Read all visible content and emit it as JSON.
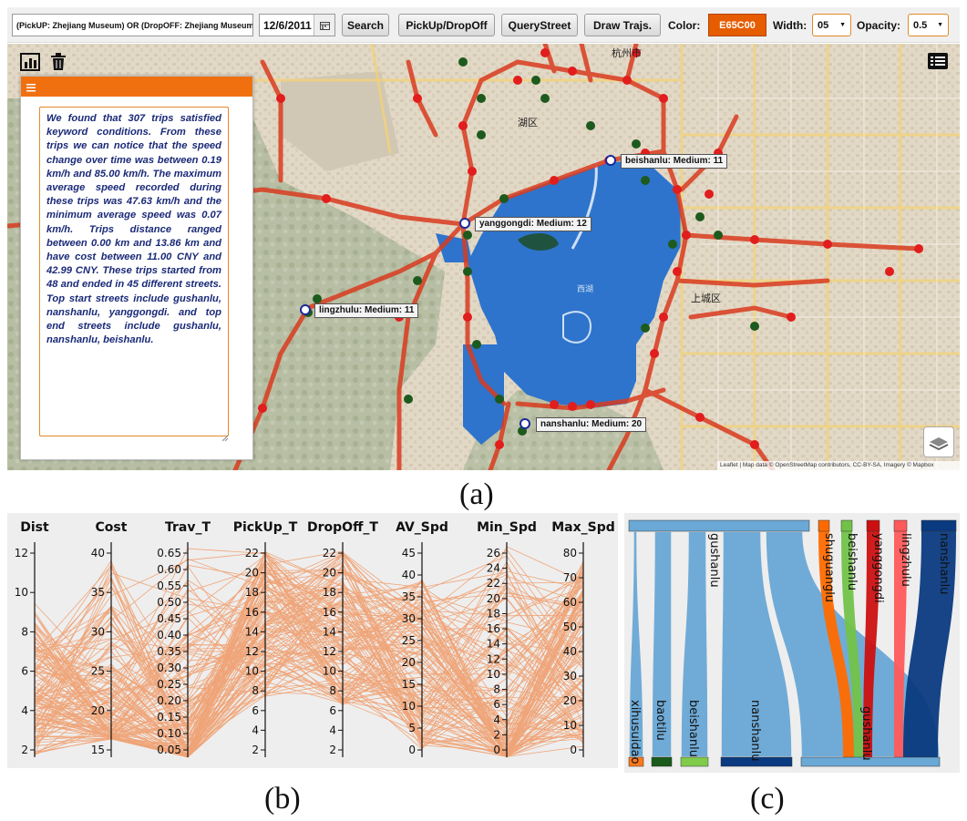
{
  "toolbar": {
    "query": "(PickUP: Zhejiang Museum) OR (DropOFF: Zhejiang Museum)",
    "date": "12/6/2011",
    "calendar_icon": "calendar-icon",
    "search_label": "Search",
    "pickup_label": "PickUp/DropOff",
    "querystreet_label": "QueryStreet",
    "draw_label": "Draw Trajs.",
    "color_label": "Color:",
    "color_value": "E65C00",
    "width_label": "Width:",
    "width_value": "05",
    "opacity_label": "Opacity:",
    "opacity_value": "0.5"
  },
  "colors": {
    "accent": "#E65C00",
    "water": "#2e74cc",
    "trajectory": "#d93b1f",
    "node_red": "#e11d1d",
    "node_green": "#1d5a1d"
  },
  "map": {
    "district_labels": [
      "杭州市",
      "湖区",
      "西湖",
      "上城区"
    ],
    "markers": [
      {
        "name": "beishanlu",
        "label": "beishanlu: Medium: 11"
      },
      {
        "name": "yanggongdi",
        "label": "yanggongdi: Medium: 12"
      },
      {
        "name": "lingzhulu",
        "label": "lingzhulu: Medium: 11"
      },
      {
        "name": "nanshanlu",
        "label": "nanshanlu: Medium: 20"
      }
    ],
    "attribution": "Leaflet | Map data © OpenStreetMap contributors, CC-BY-SA, Imagery © Mapbox"
  },
  "panel": {
    "summary": "We found that 307 trips satisfied keyword conditions. From these trips we can notice that the speed change over time was between 0.19 km/h and 85.00 km/h. The maximum average speed recorded during these trips was 47.63 km/h and the minimum average speed was 0.07 km/h. Trips distance ranged between 0.00 km and 13.86 km and have cost between 11.00 CNY and 42.99 CNY. These trips started from 48 and ended in 45 different streets. Top start streets include gushanlu, nanshanlu, yanggongdi. and top end streets include gushanlu, nanshanlu, beishanlu."
  },
  "captions": {
    "a": "(a)",
    "b": "(b)",
    "c": "(c)"
  },
  "parallel_coords": {
    "axes": [
      {
        "name": "Dist",
        "ticks": [
          "12",
          "10",
          "8",
          "6",
          "4",
          "2"
        ]
      },
      {
        "name": "Cost",
        "ticks": [
          "40",
          "35",
          "30",
          "25",
          "20",
          "15"
        ]
      },
      {
        "name": "Trav_T",
        "ticks": [
          "0.65",
          "0.60",
          "0.55",
          "0.50",
          "0.45",
          "0.40",
          "0.35",
          "0.30",
          "0.25",
          "0.20",
          "0.15",
          "0.10",
          "0.05"
        ]
      },
      {
        "name": "PickUp_T",
        "ticks": [
          "22",
          "20",
          "18",
          "16",
          "14",
          "12",
          "10",
          "8",
          "6",
          "4",
          "2"
        ]
      },
      {
        "name": "DropOff_T",
        "ticks": [
          "22",
          "20",
          "18",
          "16",
          "14",
          "12",
          "10",
          "8",
          "6",
          "4",
          "2"
        ]
      },
      {
        "name": "AV_Spd",
        "ticks": [
          "45",
          "40",
          "35",
          "30",
          "25",
          "20",
          "15",
          "10",
          "5",
          "0"
        ]
      },
      {
        "name": "Min_Spd",
        "ticks": [
          "26",
          "24",
          "22",
          "20",
          "18",
          "16",
          "14",
          "12",
          "10",
          "8",
          "6",
          "4",
          "2",
          "0"
        ]
      },
      {
        "name": "Max_Spd",
        "ticks": [
          "80",
          "70",
          "60",
          "50",
          "40",
          "30",
          "20",
          "10",
          "0"
        ]
      }
    ]
  },
  "sankey": {
    "sources": [
      {
        "label": "gushanlu",
        "color": "#6aa8d6"
      },
      {
        "label": "shuguanglu",
        "color": "#ff6a00"
      },
      {
        "label": "beishanlu",
        "color": "#72c24a"
      },
      {
        "label": "yanggongdi",
        "color": "#cc1010"
      },
      {
        "label": "lingzhulu",
        "color": "#ff5a5a"
      },
      {
        "label": "nanshanlu",
        "color": "#0a3a80"
      }
    ],
    "targets": [
      {
        "label": "xihusuidao",
        "color": "#ff7a1a"
      },
      {
        "label": "baotilu",
        "color": "#1a5a1a"
      },
      {
        "label": "beishanlu",
        "color": "#80cc4a"
      },
      {
        "label": "nanshanlu",
        "color": "#0a3a80"
      },
      {
        "label": "gushanlu",
        "color": "#6aa8d6"
      }
    ]
  }
}
